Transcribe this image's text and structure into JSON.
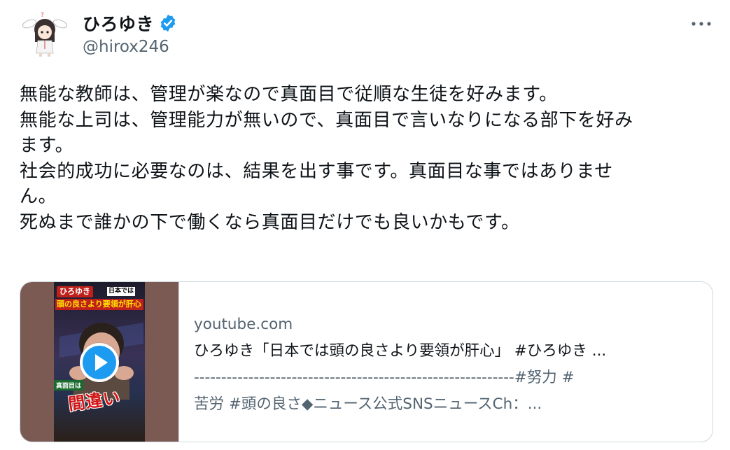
{
  "author": {
    "display_name": "ひろゆき",
    "handle": "@hirox246",
    "verified": true,
    "avatar_icon": "rabbit-ear-girl-avatar"
  },
  "more_menu_icon": "more-horizontal-icon",
  "tweet": {
    "lines": [
      "無能な教師は、管理が楽なので真面目で従順な生徒を好みます。",
      "無能な上司は、管理能力が無いので、真面目で言いなりになる部下を好み",
      "ます。",
      "社会的成功に必要なのは、結果を出す事です。真面目な事ではありませ",
      "ん。",
      "死ぬまで誰かの下で働くなら真面目だけでも良いかもです。"
    ]
  },
  "link_card": {
    "domain": "youtube.com",
    "title": "ひろゆき「日本では頭の良さより要領が肝心」 #ひろゆき ...",
    "description_lines": [
      "-----------------------------------------------------------#努力 #",
      "苦労 #頭の良さ◆ニュース公式SNSニュースCh：..."
    ],
    "thumbnail": {
      "badge": "ひろゆき",
      "badge_sub": "日本では",
      "headline": "頭の良さより要領が肝心",
      "stamp": "真面目は",
      "big_text": "間違い"
    },
    "play_icon": "play-icon"
  },
  "colors": {
    "text": "#0f1419",
    "secondary": "#536471",
    "verified_blue": "#1d9bf0",
    "border": "#cfd9de"
  }
}
